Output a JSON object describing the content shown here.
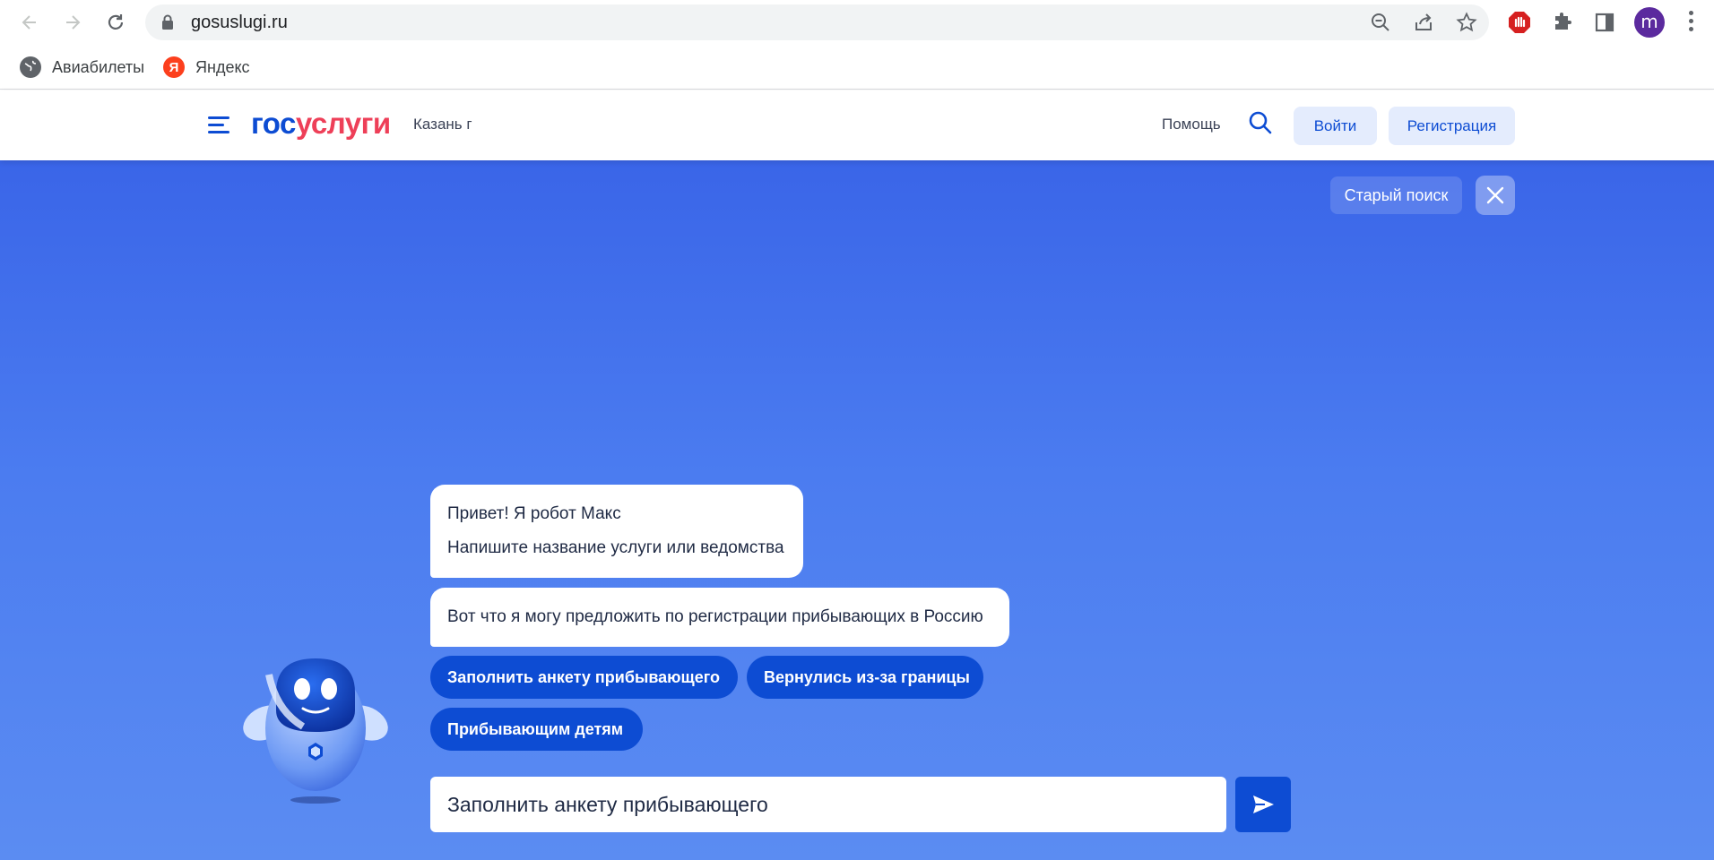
{
  "browser": {
    "url": "gosuslugi.ru",
    "profile_initial": "m",
    "bookmarks": [
      {
        "label": "Авиабилеты",
        "icon": "globe-icon"
      },
      {
        "label": "Яндекс",
        "icon": "yandex-icon"
      }
    ]
  },
  "header": {
    "logo_part1": "гос",
    "logo_part2": "услуги",
    "city": "Казань г",
    "help": "Помощь",
    "login": "Войти",
    "register": "Регистрация"
  },
  "main": {
    "old_search": "Старый поиск",
    "greeting_line1": "Привет! Я робот Макс",
    "greeting_line2": "Напишите название услуги или ведомства",
    "suggestion_text": "Вот что я могу предложить по регистрации прибывающих в Россию",
    "chips": [
      "Заполнить анкету прибывающего",
      "Вернулись из-за границы",
      "Прибывающим детям"
    ],
    "input_value": "Заполнить анкету прибывающего"
  },
  "colors": {
    "brand_blue": "#0d4cd3",
    "brand_red": "#ee3f58",
    "area_top": "#3a65e8",
    "area_bottom": "#5b8cf2"
  }
}
